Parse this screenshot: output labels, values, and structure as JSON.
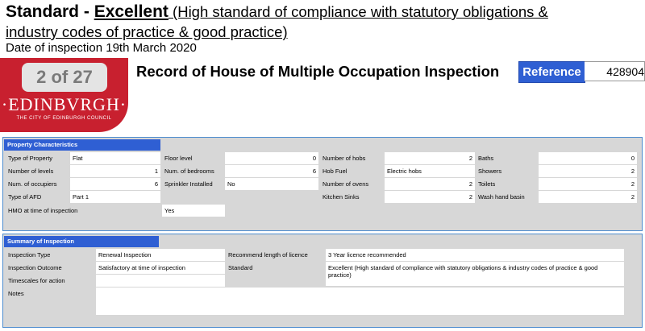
{
  "header": {
    "rating_prefix": "Standard - ",
    "rating": "Excellent",
    "rating_desc_1": " (High standard of compliance with statutory obligations &",
    "rating_desc_2": "industry codes of practice & good practice)",
    "inspection_date": "Date of inspection 19th March 2020"
  },
  "logo": {
    "page_badge": "2 of 27",
    "word": "·EDINBVRGH·",
    "subtitle": "THE CITY OF EDINBURGH COUNCIL",
    "colors": {
      "red": "#c8202f"
    }
  },
  "document": {
    "title": "Record of House of Multiple Occupation Inspection",
    "reference_label": "Reference",
    "reference_value": "428904"
  },
  "property": {
    "heading": "Property Characteristics",
    "type_label": "Type of Property",
    "type_value": "Flat",
    "floor_label": "Floor level",
    "floor_value": "0",
    "hobs_label": "Number of hobs",
    "hobs_value": "2",
    "baths_label": "Baths",
    "baths_value": "0",
    "levels_label": "Number of levels",
    "levels_value": "1",
    "bedrooms_label": "Num. of bedrooms",
    "bedrooms_value": "6",
    "hobfuel_label": "Hob Fuel",
    "hobfuel_value": "Electric hobs",
    "showers_label": "Showers",
    "showers_value": "2",
    "occupiers_label": "Num. of occupiers",
    "occupiers_value": "6",
    "sprinkler_label": "Sprinkler Installed",
    "sprinkler_value": "No",
    "ovens_label": "Number of ovens",
    "ovens_value": "2",
    "toilets_label": "Toilets",
    "toilets_value": "2",
    "afd_label": "Type of AFD",
    "afd_value": "Part 1",
    "sinks_label": "Kitchen Sinks",
    "sinks_value": "2",
    "washbasin_label": "Wash hand basin",
    "washbasin_value": "2",
    "hmo_label": "HMO at time of inspection",
    "hmo_value": "Yes"
  },
  "summary": {
    "heading": "Summary of Inspection",
    "type_label": "Inspection Type",
    "type_value": "Renewal Inspection",
    "licence_label": "Recommend length of licence",
    "licence_value": "3 Year licence recommended",
    "outcome_label": "Inspection Outcome",
    "outcome_value": "Satisfactory at time of inspection",
    "standard_label": "Standard",
    "standard_value": "Excellent (High standard of compliance with statutory obligations & industry codes of practice & good practice)",
    "timescales_label": "Timescales for action",
    "timescales_value": "",
    "notes_label": "Notes",
    "notes_value": ""
  },
  "colors": {
    "section_header": "#2f5fd3",
    "panel_bg": "#d7d7d7",
    "panel_border": "#4d8ccf"
  }
}
